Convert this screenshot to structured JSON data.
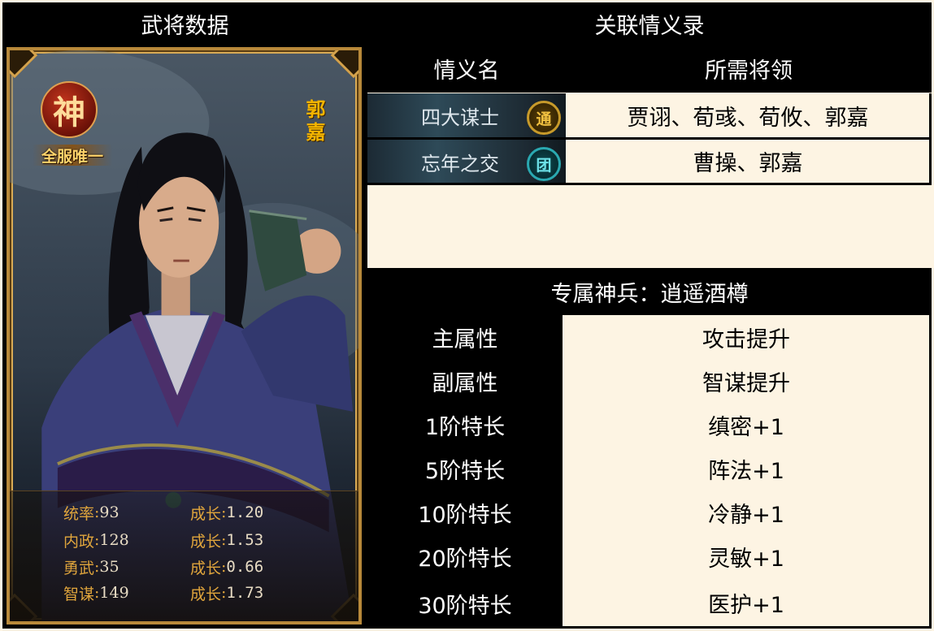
{
  "left_header": "武将数据",
  "card": {
    "badge": "神",
    "unique": "全服唯一",
    "name": "郭嘉",
    "stats": [
      {
        "label": "统率",
        "value": "93",
        "growth_label": "成长",
        "growth": "1.20"
      },
      {
        "label": "内政",
        "value": "128",
        "growth_label": "成长",
        "growth": "1.53"
      },
      {
        "label": "勇武",
        "value": "35",
        "growth_label": "成长",
        "growth": "0.66"
      },
      {
        "label": "智谋",
        "value": "149",
        "growth_label": "成长",
        "growth": "1.73"
      }
    ]
  },
  "relations": {
    "title": "关联情义录",
    "col_name": "情义名",
    "col_required": "所需将领",
    "rows": [
      {
        "name": "四大谋士",
        "icon_text": "通",
        "icon": "gold-seal-icon",
        "required": "贾诩、荀彧、荀攸、郭嘉"
      },
      {
        "name": "忘年之交",
        "icon_text": "团",
        "icon": "teal-seal-icon",
        "required": "曹操、郭嘉"
      }
    ]
  },
  "weapon": {
    "title": "专属神兵：逍遥酒樽",
    "rows": [
      {
        "label": "主属性",
        "value": "攻击提升"
      },
      {
        "label": "副属性",
        "value": "智谋提升"
      },
      {
        "label": "1阶特长",
        "value": "缜密+1"
      },
      {
        "label": "5阶特长",
        "value": "阵法+1"
      },
      {
        "label": "10阶特长",
        "value": "冷静+1"
      },
      {
        "label": "20阶特长",
        "value": "灵敏+1"
      },
      {
        "label": "30阶特长",
        "value": "医护+1"
      }
    ]
  },
  "colors": {
    "background": "#fdf4e3",
    "header": "#000000",
    "gold": "#e0a53c",
    "name_gold": "#f3b400"
  }
}
